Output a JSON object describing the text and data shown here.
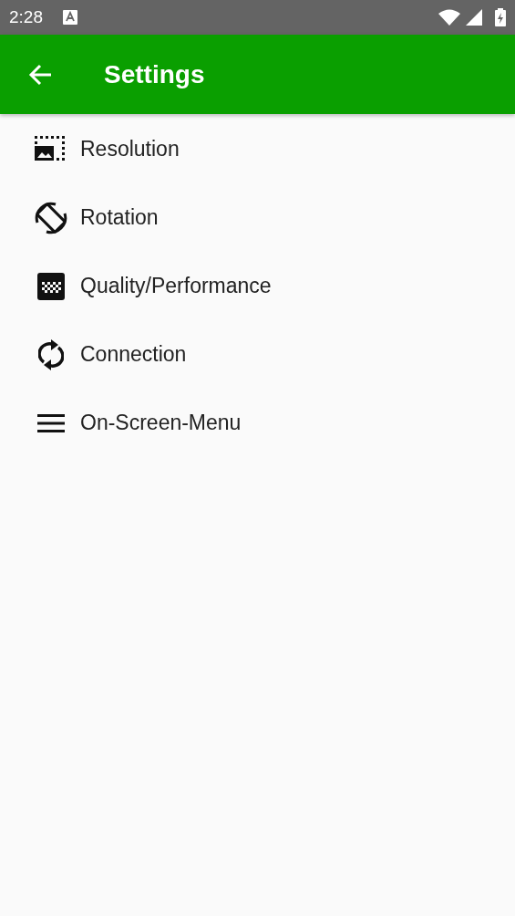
{
  "status_bar": {
    "time": "2:28"
  },
  "app_bar": {
    "title": "Settings"
  },
  "items": [
    {
      "label": "Resolution"
    },
    {
      "label": "Rotation"
    },
    {
      "label": "Quality/Performance"
    },
    {
      "label": "Connection"
    },
    {
      "label": "On-Screen-Menu"
    }
  ]
}
